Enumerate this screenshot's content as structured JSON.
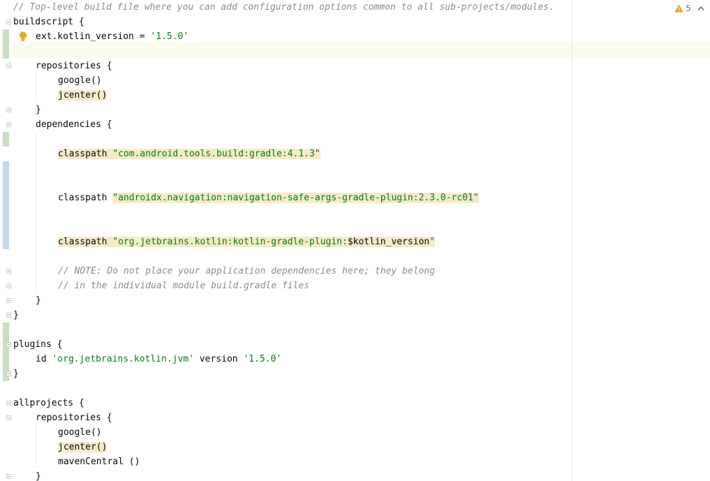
{
  "editor": {
    "inspection_count": "5",
    "lines": [
      {
        "id": "l1",
        "indent": 0,
        "tokens": [
          {
            "t": "// Top-level build file where you can add configuration options common to all sub-projects/modules.",
            "c": "cm"
          }
        ]
      },
      {
        "id": "l2",
        "indent": 0,
        "tokens": [
          {
            "t": "buildscript {",
            "c": "kw"
          }
        ]
      },
      {
        "id": "l3",
        "indent": 1,
        "tokens": [
          {
            "t": "ext.kotlin_version = ",
            "c": "kw"
          },
          {
            "t": "'1.5.0'",
            "c": "str"
          }
        ]
      },
      {
        "id": "l4",
        "indent": 0,
        "tokens": []
      },
      {
        "id": "l5",
        "indent": 1,
        "tokens": [
          {
            "t": "repositories {",
            "c": "kw"
          }
        ]
      },
      {
        "id": "l6",
        "indent": 2,
        "tokens": [
          {
            "t": "google()",
            "c": "kw"
          }
        ]
      },
      {
        "id": "l7",
        "indent": 2,
        "tokens": [
          {
            "t": "jcenter()",
            "c": "kw hl"
          }
        ]
      },
      {
        "id": "l8",
        "indent": 1,
        "tokens": [
          {
            "t": "}",
            "c": "kw"
          }
        ]
      },
      {
        "id": "l9",
        "indent": 1,
        "tokens": [
          {
            "t": "dependencies {",
            "c": "kw"
          }
        ]
      },
      {
        "id": "l10",
        "indent": 0,
        "tokens": []
      },
      {
        "id": "l11",
        "indent": 2,
        "tokens": [
          {
            "t": "classpath ",
            "c": "kw hl"
          },
          {
            "t": "\"com.android.tools.build:gradle:4.1.3\"",
            "c": "str hl"
          }
        ]
      },
      {
        "id": "l12",
        "indent": 0,
        "tokens": []
      },
      {
        "id": "l13",
        "indent": 0,
        "tokens": []
      },
      {
        "id": "l14",
        "indent": 2,
        "tokens": [
          {
            "t": "classpath ",
            "c": "kw"
          },
          {
            "t": "\"androidx.navigation:navigation-safe-args-gradle-plugin:2.3.0-rc01\"",
            "c": "str hl"
          }
        ]
      },
      {
        "id": "l15",
        "indent": 0,
        "tokens": []
      },
      {
        "id": "l16",
        "indent": 0,
        "tokens": []
      },
      {
        "id": "l17",
        "indent": 2,
        "tokens": [
          {
            "t": "classpath ",
            "c": "kw hl"
          },
          {
            "t": "\"org.jetbrains.kotlin:kotlin-gradle-plugin:",
            "c": "str hl"
          },
          {
            "t": "$kotlin_version",
            "c": "kw hl"
          },
          {
            "t": "\"",
            "c": "str hl"
          }
        ]
      },
      {
        "id": "l18",
        "indent": 0,
        "tokens": []
      },
      {
        "id": "l19",
        "indent": 2,
        "tokens": [
          {
            "t": "// NOTE: Do not place your application dependencies here; they belong",
            "c": "cm"
          }
        ]
      },
      {
        "id": "l20",
        "indent": 2,
        "tokens": [
          {
            "t": "// in the individual module build.gradle files",
            "c": "cm"
          }
        ]
      },
      {
        "id": "l21",
        "indent": 1,
        "tokens": [
          {
            "t": "}",
            "c": "kw"
          }
        ]
      },
      {
        "id": "l22",
        "indent": 0,
        "tokens": [
          {
            "t": "}",
            "c": "kw"
          }
        ]
      },
      {
        "id": "l23",
        "indent": 0,
        "tokens": []
      },
      {
        "id": "l24",
        "indent": 0,
        "tokens": [
          {
            "t": "plugins {",
            "c": "kw"
          }
        ]
      },
      {
        "id": "l25",
        "indent": 1,
        "tokens": [
          {
            "t": "id ",
            "c": "kw"
          },
          {
            "t": "'org.jetbrains.kotlin.jvm'",
            "c": "str"
          },
          {
            "t": " version ",
            "c": "kw"
          },
          {
            "t": "'1.5.0'",
            "c": "str"
          }
        ]
      },
      {
        "id": "l26",
        "indent": 0,
        "tokens": [
          {
            "t": "}",
            "c": "kw"
          }
        ]
      },
      {
        "id": "l27",
        "indent": 0,
        "tokens": []
      },
      {
        "id": "l28",
        "indent": 0,
        "tokens": [
          {
            "t": "allprojects {",
            "c": "kw"
          }
        ]
      },
      {
        "id": "l29",
        "indent": 1,
        "tokens": [
          {
            "t": "repositories {",
            "c": "kw"
          }
        ]
      },
      {
        "id": "l30",
        "indent": 2,
        "tokens": [
          {
            "t": "google()",
            "c": "kw"
          }
        ]
      },
      {
        "id": "l31",
        "indent": 2,
        "tokens": [
          {
            "t": "jcenter()",
            "c": "kw hl"
          }
        ]
      },
      {
        "id": "l32",
        "indent": 2,
        "tokens": [
          {
            "t": "mavenCentral ()",
            "c": "kw"
          }
        ]
      },
      {
        "id": "l33",
        "indent": 1,
        "tokens": [
          {
            "t": "}",
            "c": "kw"
          }
        ]
      }
    ]
  },
  "gutter": {
    "changed_color": "#c9dfc1",
    "modified_color": "#c5d7ea",
    "fold_lines": [
      2,
      5,
      8,
      9,
      19,
      20,
      21,
      22,
      24,
      26,
      28,
      29,
      33
    ],
    "added_ranges": [
      [
        3,
        4
      ],
      [
        10,
        10
      ],
      [
        23,
        26
      ]
    ],
    "modified_ranges": [
      [
        12,
        17
      ]
    ]
  },
  "colors": {
    "string": "#067d17",
    "comment": "#8c8c8c",
    "highlight": "#f5eac9",
    "warning": "#e3a21a"
  }
}
